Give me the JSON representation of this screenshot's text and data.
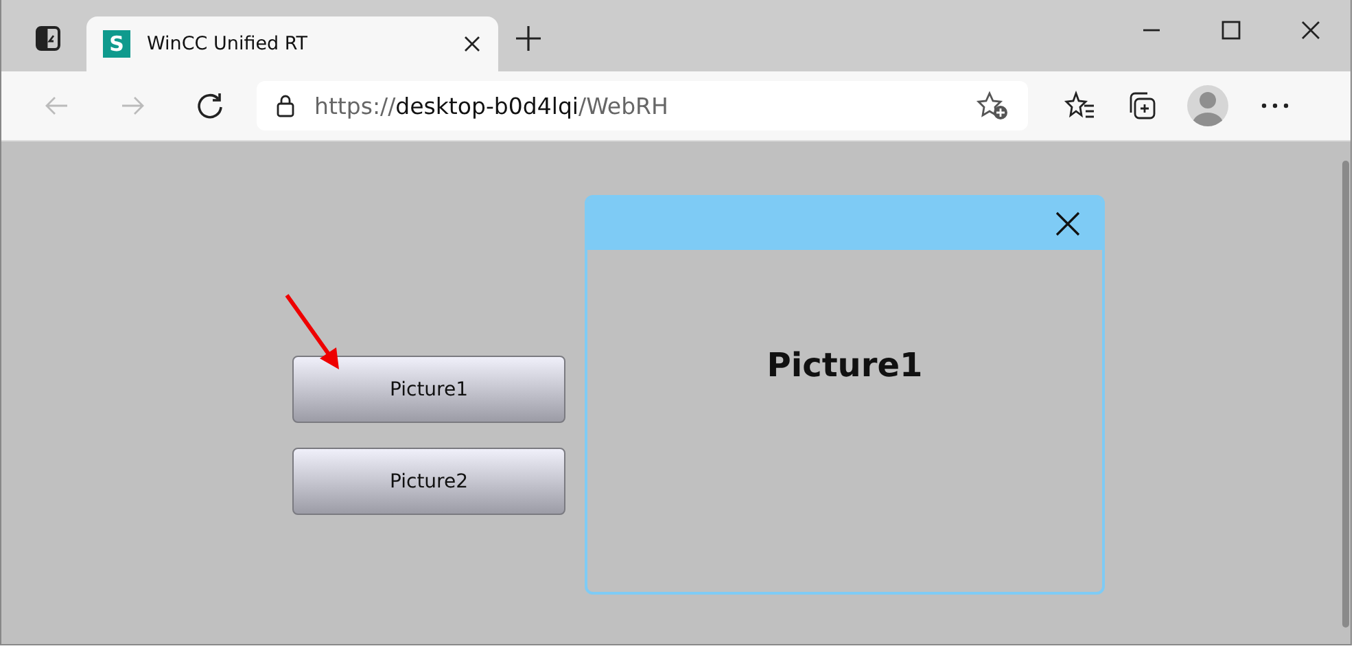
{
  "browser": {
    "tab": {
      "title": "WinCC Unified RT",
      "favicon_letter": "S",
      "selected": true
    },
    "address": {
      "scheme": "https://",
      "host": "desktop-b0d4lqi",
      "path": "/WebRH"
    }
  },
  "screen": {
    "buttons": [
      {
        "label": "Picture1"
      },
      {
        "label": "Picture2"
      }
    ],
    "popup": {
      "content_title": "Picture1"
    }
  }
}
